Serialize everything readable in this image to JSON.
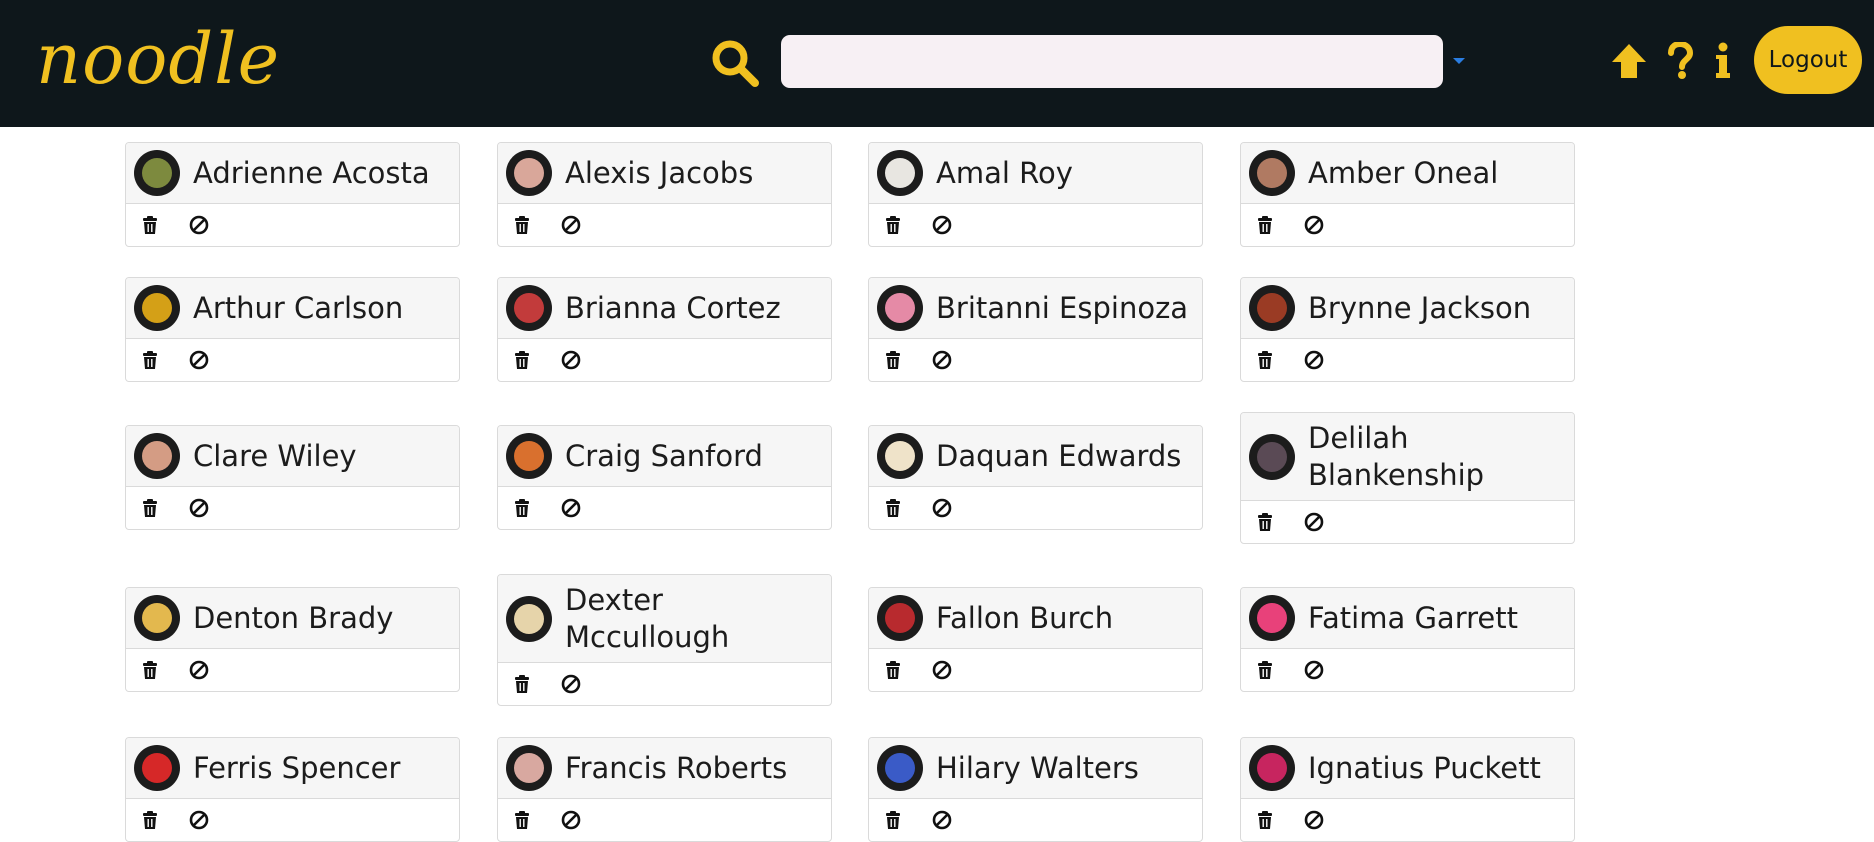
{
  "app": {
    "logo": "noodle",
    "colors": {
      "navbar": "#0e171b",
      "accent": "#f0c020",
      "caret": "#2a7de1"
    }
  },
  "search": {
    "value": "",
    "placeholder": ""
  },
  "nav": {
    "icons": [
      "arrow-up-icon",
      "question-icon",
      "info-icon"
    ],
    "logout_label": "Logout"
  },
  "users": [
    {
      "name": "Adrienne Acosta",
      "avatar_color": "#7d8a3e"
    },
    {
      "name": "Alexis Jacobs",
      "avatar_color": "#d9a79a"
    },
    {
      "name": "Amal Roy",
      "avatar_color": "#e8e6e1"
    },
    {
      "name": "Amber Oneal",
      "avatar_color": "#b07a62"
    },
    {
      "name": "Arthur Carlson",
      "avatar_color": "#d4a017"
    },
    {
      "name": "Brianna Cortez",
      "avatar_color": "#c23b3b"
    },
    {
      "name": "Britanni Espinoza",
      "avatar_color": "#e58aa6"
    },
    {
      "name": "Brynne Jackson",
      "avatar_color": "#9a3b24"
    },
    {
      "name": "Clare Wiley",
      "avatar_color": "#d49c84"
    },
    {
      "name": "Craig Sanford",
      "avatar_color": "#d9702e"
    },
    {
      "name": "Daquan Edwards",
      "avatar_color": "#efe3c9"
    },
    {
      "name": "Delilah Blankenship",
      "avatar_color": "#5a4a55"
    },
    {
      "name": "Denton Brady",
      "avatar_color": "#e3b84e"
    },
    {
      "name": "Dexter Mccullough",
      "avatar_color": "#e6d4aa"
    },
    {
      "name": "Fallon Burch",
      "avatar_color": "#b82a2e"
    },
    {
      "name": "Fatima Garrett",
      "avatar_color": "#e8417a"
    },
    {
      "name": "Ferris Spencer",
      "avatar_color": "#d62828"
    },
    {
      "name": "Francis Roberts",
      "avatar_color": "#d8a8a0"
    },
    {
      "name": "Hilary Walters",
      "avatar_color": "#3a5bc7"
    },
    {
      "name": "Ignatius Puckett",
      "avatar_color": "#c7255f"
    }
  ]
}
